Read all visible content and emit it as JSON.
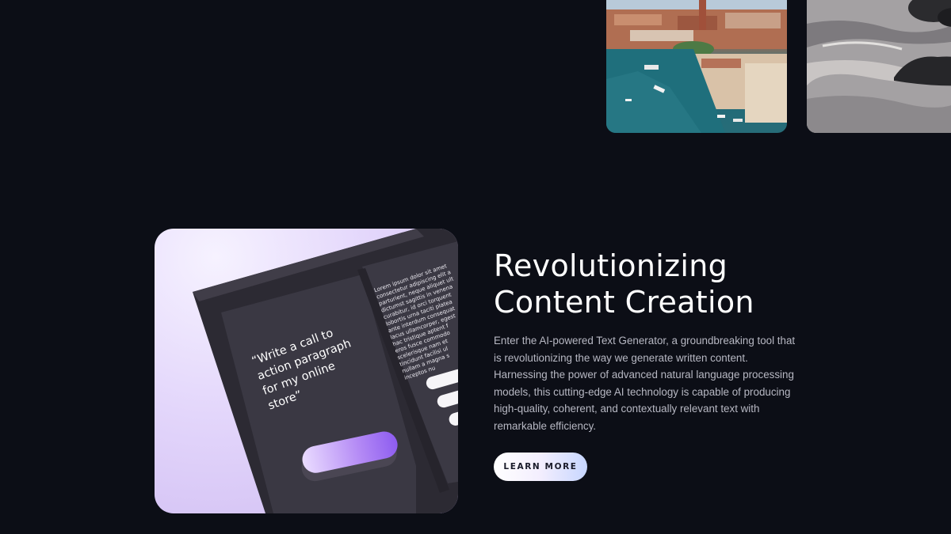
{
  "gallery": {
    "images": [
      {
        "name": "venice-aerial-image"
      },
      {
        "name": "rocky-sea-image"
      }
    ]
  },
  "feature": {
    "illustration": {
      "prompt_text": [
        "“Write a call to",
        "action paragraph",
        "for my online",
        "store”"
      ],
      "lorem_lines": [
        "Lorem ipsum dolor sit amet",
        "consectetur adipiscing elit a",
        "parturient, neque aliquet ult",
        "dictumst sagittis in venena",
        "curabitur, id orci torquent",
        "lobortis urna taciti platea",
        "ante interdum consequat",
        "lacus ullamcorper, egest",
        "hac tristique aptent f",
        "eros fusce commodo",
        "scelerisque nam et",
        "tincidunt facilisi ul",
        "nullam a magna s",
        "inceptos nu"
      ]
    },
    "headline_line1": "Revolutionizing",
    "headline_line2": "Content Creation",
    "description": "Enter the AI-powered Text Generator, a groundbreaking tool that is revolutionizing the way we generate written content. Harnessing the power of advanced natural language processing models, this cutting-edge AI technology is capable of producing high-quality, coherent, and contextually relevant text with remarkable efficiency.",
    "cta_label": "LEARN MORE"
  },
  "colors": {
    "background": "#0c0e16",
    "accent_purple": "#9d6cf2",
    "text_muted": "#b7b8c3"
  }
}
